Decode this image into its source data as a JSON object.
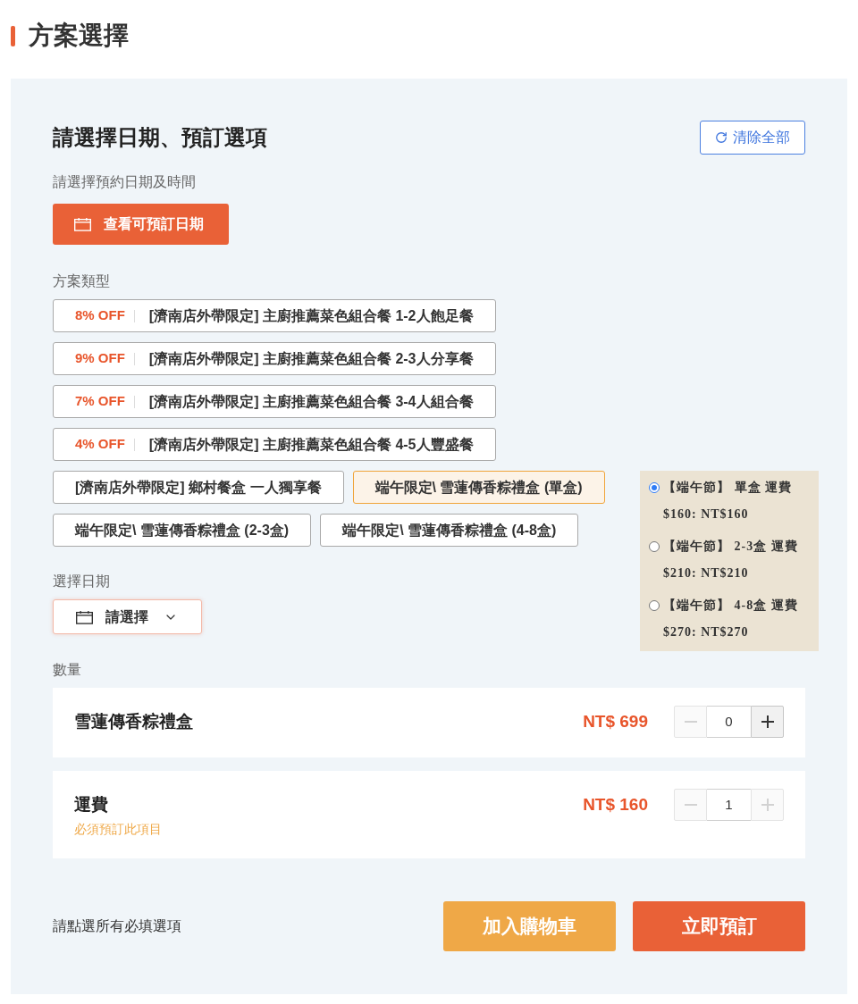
{
  "page_title": "方案選擇",
  "booking_panel": {
    "heading": "請選擇日期、預訂選項",
    "clear_button": "清除全部",
    "date_time_label": "請選擇預約日期及時間",
    "view_dates_button": "查看可預訂日期",
    "plan_type_label": "方案類型",
    "plans": [
      {
        "discount": "8% OFF",
        "title": "[濟南店外帶限定] 主廚推薦菜色組合餐 1-2人飽足餐",
        "selected": false
      },
      {
        "discount": "9% OFF",
        "title": "[濟南店外帶限定] 主廚推薦菜色組合餐 2-3人分享餐",
        "selected": false
      },
      {
        "discount": "7% OFF",
        "title": "[濟南店外帶限定] 主廚推薦菜色組合餐 3-4人組合餐",
        "selected": false
      },
      {
        "discount": "4% OFF",
        "title": "[濟南店外帶限定] 主廚推薦菜色組合餐 4-5人豐盛餐",
        "selected": false
      },
      {
        "title": "[濟南店外帶限定] 鄉村餐盒 一人獨享餐",
        "selected": false
      },
      {
        "title": "端午限定\\ 雪蓮傳香粽禮盒 (單盒)",
        "selected": true
      },
      {
        "title": "端午限定\\ 雪蓮傳香粽禮盒 (2-3盒)",
        "selected": false
      },
      {
        "title": "端午限定\\ 雪蓮傳香粽禮盒 (4-8盒)",
        "selected": false
      }
    ],
    "shipping_options": [
      {
        "name": "【端午節】 單盒 運費",
        "price": "$160: NT$160",
        "selected": true
      },
      {
        "name": "【端午節】 2-3盒 運費",
        "price": "$210: NT$210",
        "selected": false
      },
      {
        "name": "【端午節】 4-8盒 運費",
        "price": "$270: NT$270",
        "selected": false
      }
    ],
    "date_label": "選擇日期",
    "date_select": {
      "placeholder": "請選擇"
    },
    "quantity_label": "數量",
    "items": [
      {
        "name": "雪蓮傳香粽禮盒",
        "price": "NT$ 699",
        "quantity": "0",
        "minus_disabled": true,
        "plus_disabled": false
      },
      {
        "name": "運費",
        "note": "必須預訂此項目",
        "price": "NT$ 160",
        "quantity": "1",
        "minus_disabled": true,
        "plus_disabled": true
      }
    ],
    "footer_hint": "請點選所有必填選項",
    "buttons": [
      {
        "label": "加入購物車",
        "kind": "cart"
      },
      {
        "label": "立即預訂",
        "kind": "book"
      }
    ]
  }
}
